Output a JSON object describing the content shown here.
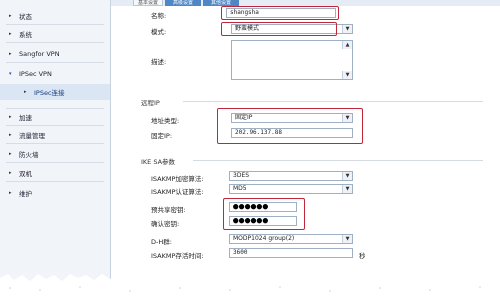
{
  "sidebar": {
    "items": [
      {
        "label": "状态",
        "arrow": "▸"
      },
      {
        "label": "系统",
        "arrow": "▸"
      },
      {
        "label": "Sangfor VPN",
        "arrow": "▸"
      },
      {
        "label": "IPSec VPN",
        "arrow": "▾"
      },
      {
        "label": "IPSec连接",
        "arrow": "▸"
      },
      {
        "label": "加速",
        "arrow": "▸"
      },
      {
        "label": "流量管理",
        "arrow": "▸"
      },
      {
        "label": "防火墙",
        "arrow": "▸"
      },
      {
        "label": "双机",
        "arrow": "▸"
      },
      {
        "label": "维护",
        "arrow": "▸"
      }
    ]
  },
  "tabs": [
    "基本设置",
    "高级设置",
    "其他设置"
  ],
  "form": {
    "name_label": "名称:",
    "name_value": "shangsha",
    "mode_label": "模式:",
    "mode_value": "野蛮模式",
    "desc_label": "描述:",
    "remote_section": "远程IP",
    "addr_type_label": "地址类型:",
    "addr_type_value": "固定IP",
    "fixed_ip_label": "固定IP:",
    "fixed_ip_value": "202.96.137.88",
    "ike_section": "IKE SA参数",
    "enc_label": "ISAKMP加密算法:",
    "enc_value": "3DES",
    "auth_label": "ISAKMP认证算法:",
    "auth_value": "MD5",
    "psk_label": "预共享密钥:",
    "psk_value": "●●●●●●",
    "confirm_label": "确认密钥:",
    "confirm_value": "●●●●●●",
    "dh_label": "D-H群:",
    "dh_value": "MODP1024 group(2)",
    "lifetime_label": "ISAKMP存活时间:",
    "lifetime_value": "3600",
    "lifetime_unit": "秒"
  },
  "colors": {
    "highlight": "#c1273b",
    "tab_active": "#4e86c6",
    "sidebar_bg": "#f1f4f8"
  }
}
